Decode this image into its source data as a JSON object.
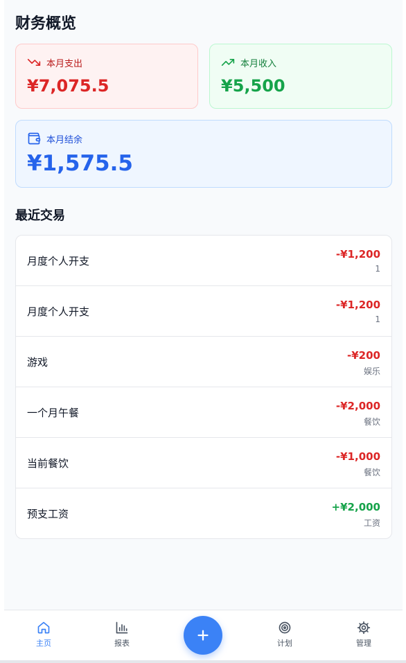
{
  "header": {
    "title": "财务概览"
  },
  "summary": {
    "expense": {
      "label": "本月支出",
      "amount": "¥7,075.5",
      "icon": "trending-down-icon",
      "color": "#dc2626"
    },
    "income": {
      "label": "本月收入",
      "amount": "¥5,500",
      "icon": "trending-up-icon",
      "color": "#16a34a"
    },
    "balance": {
      "label": "本月结余",
      "amount": "¥1,575.5",
      "icon": "wallet-icon",
      "color": "#2563eb"
    }
  },
  "recent": {
    "title": "最近交易",
    "transactions": [
      {
        "name": "月度个人开支",
        "amount": "-¥1,200",
        "category": "1"
      },
      {
        "name": "月度个人开支",
        "amount": "-¥1,200",
        "category": "1"
      },
      {
        "name": "游戏",
        "amount": "-¥200",
        "category": "娱乐"
      },
      {
        "name": "一个月午餐",
        "amount": "-¥2,000",
        "category": "餐饮"
      },
      {
        "name": "当前餐饮",
        "amount": "-¥1,000",
        "category": "餐饮"
      },
      {
        "name": "预支工资",
        "amount": "+¥2,000",
        "category": "工资"
      }
    ]
  },
  "nav": {
    "items": [
      {
        "label": "主页",
        "icon": "home-icon",
        "active": true
      },
      {
        "label": "报表",
        "icon": "bar-chart-icon",
        "active": false
      },
      {
        "label": "计划",
        "icon": "target-icon",
        "active": false
      },
      {
        "label": "管理",
        "icon": "gear-icon",
        "active": false
      }
    ],
    "fab_icon": "plus-icon",
    "accent": "#3b82f6"
  }
}
